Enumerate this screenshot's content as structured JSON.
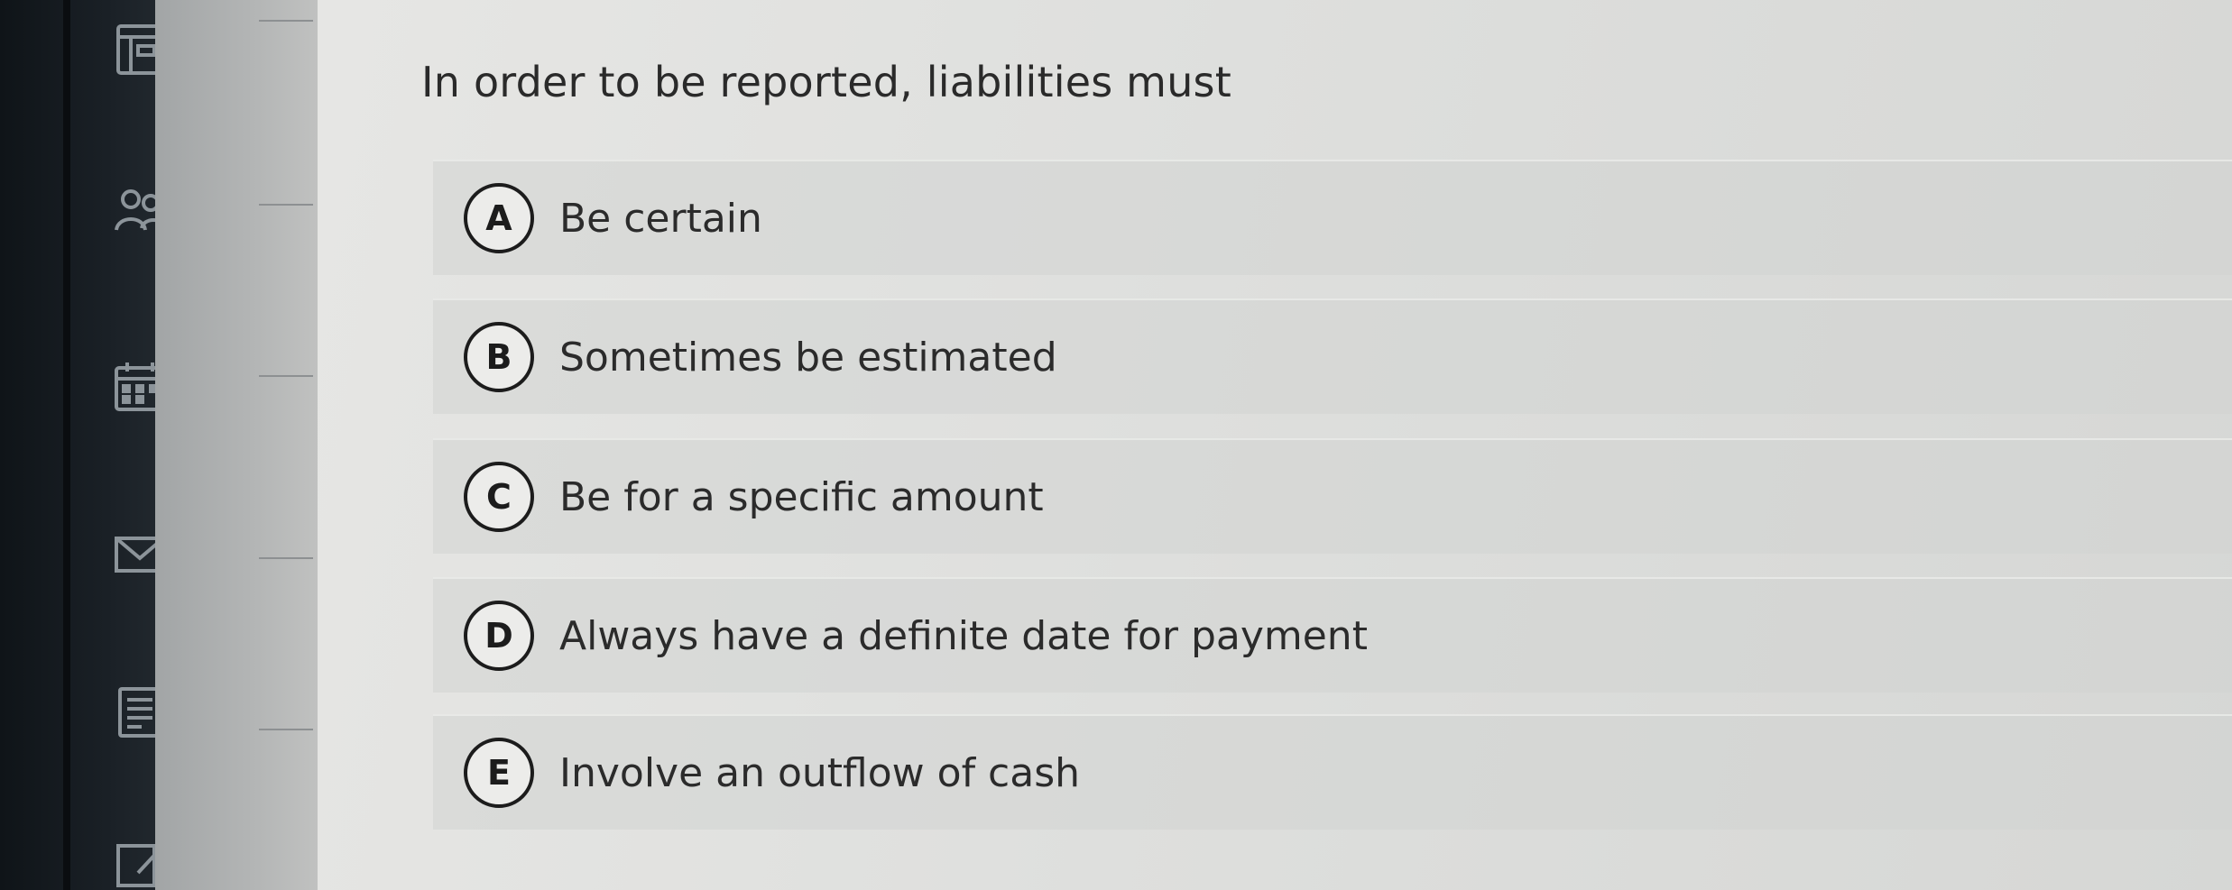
{
  "question": {
    "text": "In order to be reported, liabilities must"
  },
  "options": [
    {
      "letter": "A",
      "text": "Be certain"
    },
    {
      "letter": "B",
      "text": "Sometimes be estimated"
    },
    {
      "letter": "C",
      "text": "Be for a specific amount"
    },
    {
      "letter": "D",
      "text": "Always have a definite date for payment"
    },
    {
      "letter": "E",
      "text": "Involve an outflow of cash"
    }
  ],
  "sidebar": {
    "icons": [
      "book-icon",
      "people-icon",
      "calendar-icon",
      "mail-icon",
      "document-icon",
      "edit-icon"
    ]
  },
  "colors": {
    "sidebar": "#1a2026",
    "panel": "#dedfdd",
    "text": "#2a2a2a",
    "circle_border": "#1c1c1c"
  }
}
